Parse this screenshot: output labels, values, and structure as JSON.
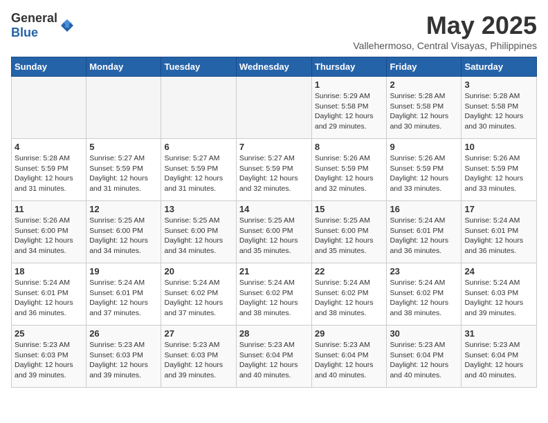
{
  "logo": {
    "general": "General",
    "blue": "Blue"
  },
  "title": "May 2025",
  "subtitle": "Vallehermoso, Central Visayas, Philippines",
  "weekdays": [
    "Sunday",
    "Monday",
    "Tuesday",
    "Wednesday",
    "Thursday",
    "Friday",
    "Saturday"
  ],
  "weeks": [
    [
      {
        "day": "",
        "info": ""
      },
      {
        "day": "",
        "info": ""
      },
      {
        "day": "",
        "info": ""
      },
      {
        "day": "",
        "info": ""
      },
      {
        "day": "1",
        "info": "Sunrise: 5:29 AM\nSunset: 5:58 PM\nDaylight: 12 hours\nand 29 minutes."
      },
      {
        "day": "2",
        "info": "Sunrise: 5:28 AM\nSunset: 5:58 PM\nDaylight: 12 hours\nand 30 minutes."
      },
      {
        "day": "3",
        "info": "Sunrise: 5:28 AM\nSunset: 5:58 PM\nDaylight: 12 hours\nand 30 minutes."
      }
    ],
    [
      {
        "day": "4",
        "info": "Sunrise: 5:28 AM\nSunset: 5:59 PM\nDaylight: 12 hours\nand 31 minutes."
      },
      {
        "day": "5",
        "info": "Sunrise: 5:27 AM\nSunset: 5:59 PM\nDaylight: 12 hours\nand 31 minutes."
      },
      {
        "day": "6",
        "info": "Sunrise: 5:27 AM\nSunset: 5:59 PM\nDaylight: 12 hours\nand 31 minutes."
      },
      {
        "day": "7",
        "info": "Sunrise: 5:27 AM\nSunset: 5:59 PM\nDaylight: 12 hours\nand 32 minutes."
      },
      {
        "day": "8",
        "info": "Sunrise: 5:26 AM\nSunset: 5:59 PM\nDaylight: 12 hours\nand 32 minutes."
      },
      {
        "day": "9",
        "info": "Sunrise: 5:26 AM\nSunset: 5:59 PM\nDaylight: 12 hours\nand 33 minutes."
      },
      {
        "day": "10",
        "info": "Sunrise: 5:26 AM\nSunset: 5:59 PM\nDaylight: 12 hours\nand 33 minutes."
      }
    ],
    [
      {
        "day": "11",
        "info": "Sunrise: 5:26 AM\nSunset: 6:00 PM\nDaylight: 12 hours\nand 34 minutes."
      },
      {
        "day": "12",
        "info": "Sunrise: 5:25 AM\nSunset: 6:00 PM\nDaylight: 12 hours\nand 34 minutes."
      },
      {
        "day": "13",
        "info": "Sunrise: 5:25 AM\nSunset: 6:00 PM\nDaylight: 12 hours\nand 34 minutes."
      },
      {
        "day": "14",
        "info": "Sunrise: 5:25 AM\nSunset: 6:00 PM\nDaylight: 12 hours\nand 35 minutes."
      },
      {
        "day": "15",
        "info": "Sunrise: 5:25 AM\nSunset: 6:00 PM\nDaylight: 12 hours\nand 35 minutes."
      },
      {
        "day": "16",
        "info": "Sunrise: 5:24 AM\nSunset: 6:01 PM\nDaylight: 12 hours\nand 36 minutes."
      },
      {
        "day": "17",
        "info": "Sunrise: 5:24 AM\nSunset: 6:01 PM\nDaylight: 12 hours\nand 36 minutes."
      }
    ],
    [
      {
        "day": "18",
        "info": "Sunrise: 5:24 AM\nSunset: 6:01 PM\nDaylight: 12 hours\nand 36 minutes."
      },
      {
        "day": "19",
        "info": "Sunrise: 5:24 AM\nSunset: 6:01 PM\nDaylight: 12 hours\nand 37 minutes."
      },
      {
        "day": "20",
        "info": "Sunrise: 5:24 AM\nSunset: 6:02 PM\nDaylight: 12 hours\nand 37 minutes."
      },
      {
        "day": "21",
        "info": "Sunrise: 5:24 AM\nSunset: 6:02 PM\nDaylight: 12 hours\nand 38 minutes."
      },
      {
        "day": "22",
        "info": "Sunrise: 5:24 AM\nSunset: 6:02 PM\nDaylight: 12 hours\nand 38 minutes."
      },
      {
        "day": "23",
        "info": "Sunrise: 5:24 AM\nSunset: 6:02 PM\nDaylight: 12 hours\nand 38 minutes."
      },
      {
        "day": "24",
        "info": "Sunrise: 5:24 AM\nSunset: 6:03 PM\nDaylight: 12 hours\nand 39 minutes."
      }
    ],
    [
      {
        "day": "25",
        "info": "Sunrise: 5:23 AM\nSunset: 6:03 PM\nDaylight: 12 hours\nand 39 minutes."
      },
      {
        "day": "26",
        "info": "Sunrise: 5:23 AM\nSunset: 6:03 PM\nDaylight: 12 hours\nand 39 minutes."
      },
      {
        "day": "27",
        "info": "Sunrise: 5:23 AM\nSunset: 6:03 PM\nDaylight: 12 hours\nand 39 minutes."
      },
      {
        "day": "28",
        "info": "Sunrise: 5:23 AM\nSunset: 6:04 PM\nDaylight: 12 hours\nand 40 minutes."
      },
      {
        "day": "29",
        "info": "Sunrise: 5:23 AM\nSunset: 6:04 PM\nDaylight: 12 hours\nand 40 minutes."
      },
      {
        "day": "30",
        "info": "Sunrise: 5:23 AM\nSunset: 6:04 PM\nDaylight: 12 hours\nand 40 minutes."
      },
      {
        "day": "31",
        "info": "Sunrise: 5:23 AM\nSunset: 6:04 PM\nDaylight: 12 hours\nand 40 minutes."
      }
    ]
  ]
}
